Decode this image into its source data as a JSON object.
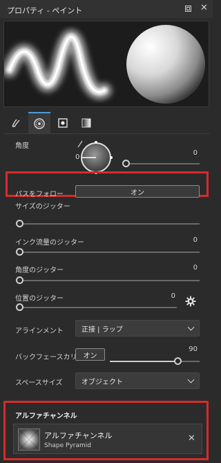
{
  "window": {
    "title": "プロパティ - ペイント"
  },
  "tabs": [
    {
      "icon": "brush-icon"
    },
    {
      "icon": "pattern-icon"
    },
    {
      "icon": "square-dot-icon"
    },
    {
      "icon": "gradient-icon"
    }
  ],
  "angle": {
    "label": "角度",
    "dial_value": "0",
    "value": "0"
  },
  "follow_path": {
    "label": "パスをフォロー",
    "button": "オン"
  },
  "size_jitter": {
    "label": "サイズのジッター"
  },
  "ink_flow_jitter": {
    "label": "インク流量のジッター",
    "value": "0"
  },
  "angle_jitter": {
    "label": "角度のジッター",
    "value": "0"
  },
  "position_jitter": {
    "label": "位置のジッター",
    "value": "0"
  },
  "alignment": {
    "label": "アラインメント",
    "value": "正接 | ラップ"
  },
  "backface_culling": {
    "label": "バックフェースカリング",
    "button": "オン",
    "value": "90",
    "level": 0.75
  },
  "space_size": {
    "label": "スペースサイズ",
    "value": "オブジェクト"
  },
  "alpha_channel": {
    "header": "アルファチャンネル",
    "name": "アルファチャンネル",
    "shape": "Shape Pyramid"
  },
  "colors": {
    "highlight_box": "#d92a2a",
    "tab_accent": "#4e9bd8"
  }
}
